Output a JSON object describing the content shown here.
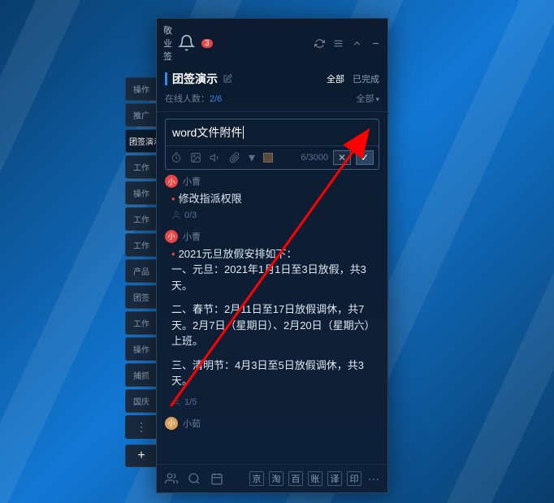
{
  "titlebar": {
    "app_name": "敬业签",
    "badge_count": "3"
  },
  "header": {
    "title": "团签演示",
    "filter_all": "全部",
    "filter_done": "已完成",
    "online_label": "在线人数：",
    "online_count": "2/6",
    "dropdown": "全部"
  },
  "sidebar": {
    "items": [
      "操作",
      "推广",
      "团签演示",
      "工作",
      "操作",
      "工作",
      "工作",
      "产品",
      "团签",
      "工作",
      "操作",
      "捕抓",
      "国庆"
    ]
  },
  "input": {
    "text": "word文件附件",
    "char_count": "6/3000"
  },
  "notes": [
    {
      "author": "小曹",
      "avatar_color": "red",
      "body": [
        "修改指派权限"
      ],
      "meta": "0/3"
    },
    {
      "author": "小曹",
      "avatar_color": "red",
      "body": [
        "2021元旦放假安排如下：\n一、元旦：2021年1月1日至3日放假，共3天。",
        "二、春节：2月11日至17日放假调休，共7天。2月7日（星期日）、2月20日（星期六）上班。",
        "三、清明节：4月3日至5日放假调休，共3天。"
      ],
      "meta": "1/5"
    },
    {
      "author": "小茹",
      "avatar_color": "gold",
      "body": [],
      "meta": ""
    }
  ],
  "footer": {
    "buttons": [
      "京",
      "淘",
      "百",
      "账",
      "译",
      "印"
    ]
  }
}
